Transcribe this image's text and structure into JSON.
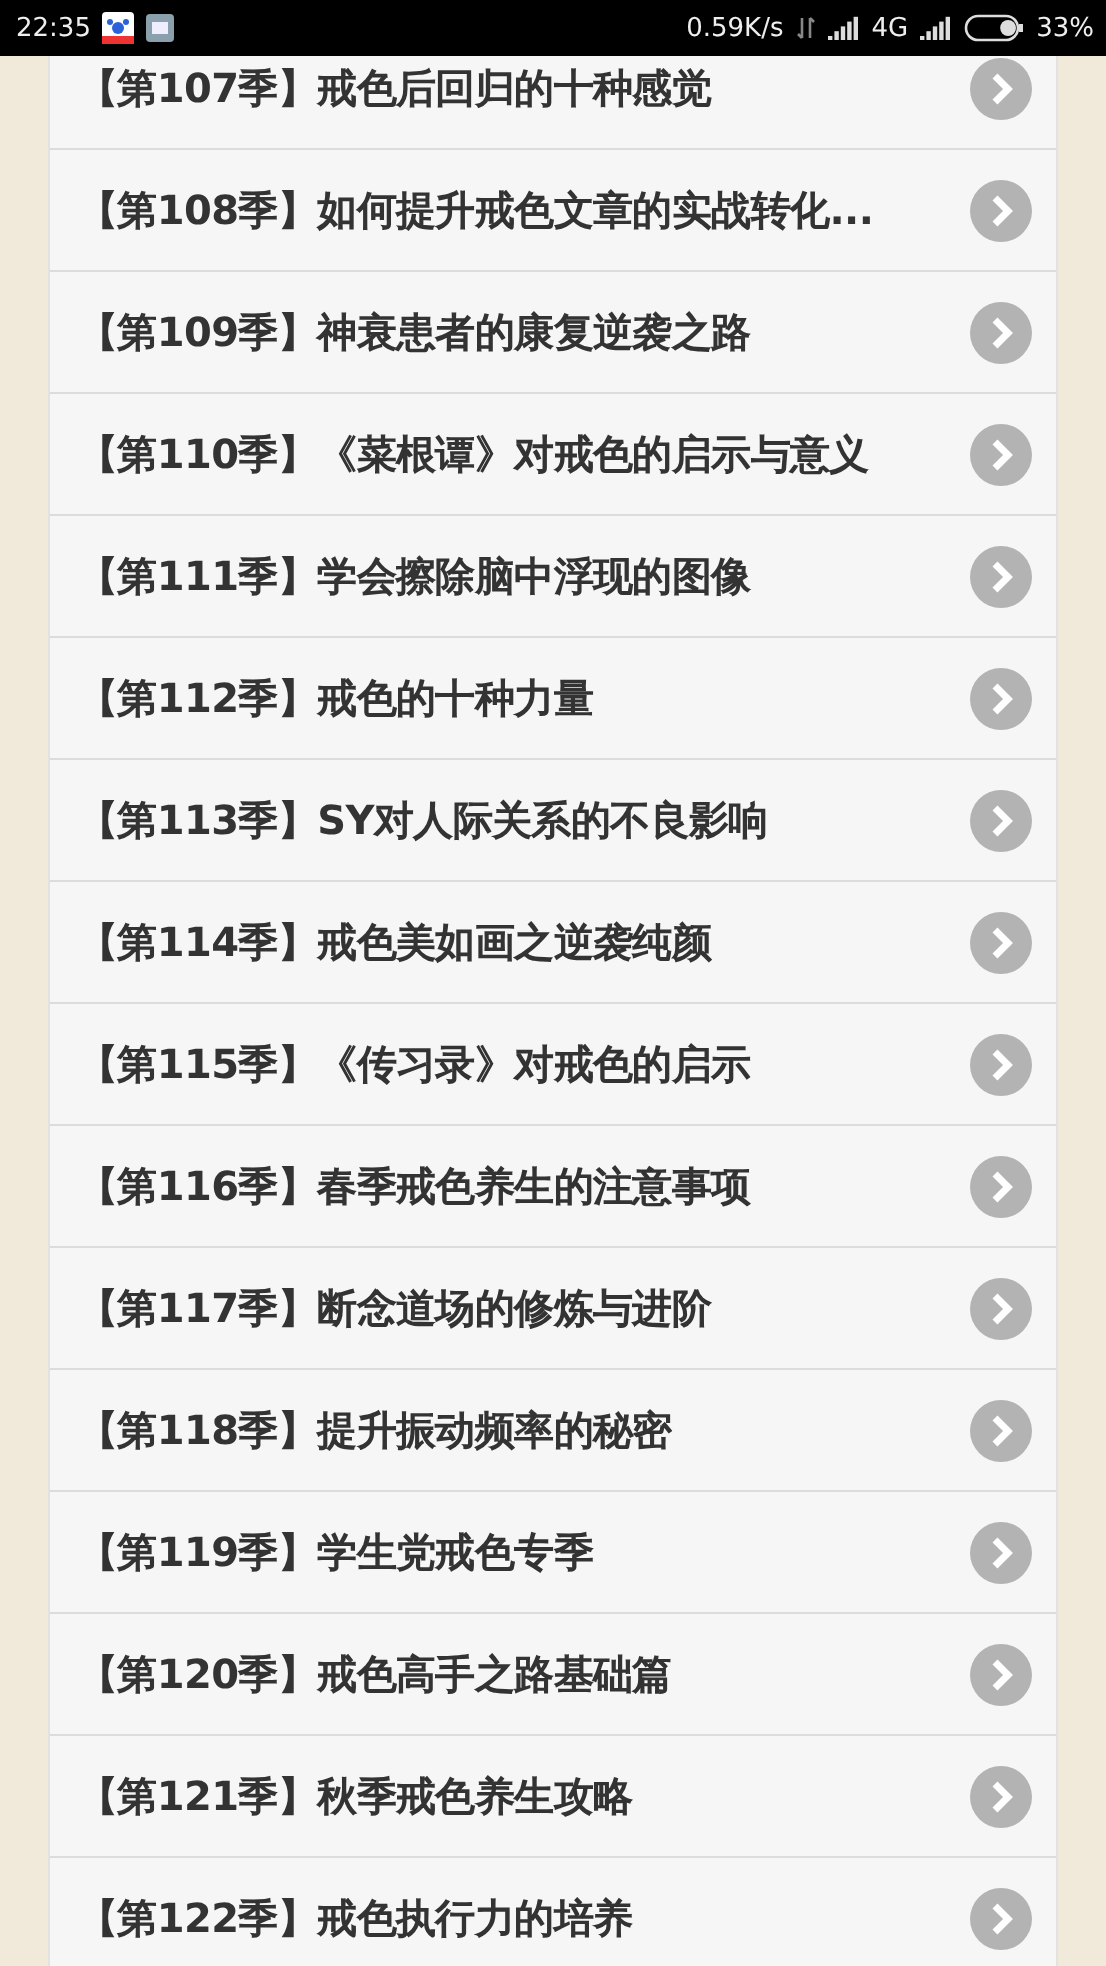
{
  "status_bar": {
    "time": "22:35",
    "speed": "0.59K/s",
    "network": "4G",
    "battery": {
      "text": "33%",
      "level": 0.33
    }
  },
  "items": [
    {
      "title": "【第107季】戒色后回归的十种感觉"
    },
    {
      "title": "【第108季】如何提升戒色文章的实战转化..."
    },
    {
      "title": "【第109季】神衰患者的康复逆袭之路"
    },
    {
      "title": "【第110季】《菜根谭》对戒色的启示与意义"
    },
    {
      "title": "【第111季】学会擦除脑中浮现的图像"
    },
    {
      "title": "【第112季】戒色的十种力量"
    },
    {
      "title": "【第113季】SY对人际关系的不良影响"
    },
    {
      "title": "【第114季】戒色美如画之逆袭纯颜"
    },
    {
      "title": "【第115季】《传习录》对戒色的启示"
    },
    {
      "title": "【第116季】春季戒色养生的注意事项"
    },
    {
      "title": "【第117季】断念道场的修炼与进阶"
    },
    {
      "title": "【第118季】提升振动频率的秘密"
    },
    {
      "title": "【第119季】学生党戒色专季"
    },
    {
      "title": "【第120季】戒色高手之路基础篇"
    },
    {
      "title": "【第121季】秋季戒色养生攻略"
    },
    {
      "title": "【第122季】戒色执行力的培养"
    }
  ]
}
